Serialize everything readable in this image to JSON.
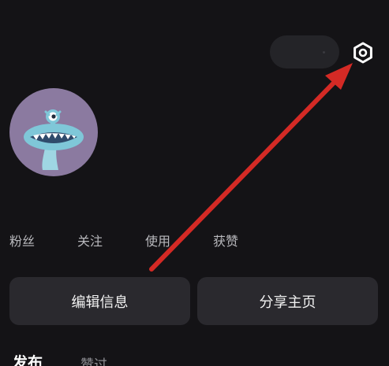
{
  "header": {
    "settings_icon": "gear-icon"
  },
  "profile": {
    "avatar_icon": "monster-avatar"
  },
  "stats": {
    "fans_label": "粉丝",
    "following_label": "关注",
    "usage_label": "使用",
    "likes_label": "获赞"
  },
  "actions": {
    "edit_label": "编辑信息",
    "share_label": "分享主页"
  },
  "tabs": {
    "publish_label": "发布",
    "liked_label": "赞过"
  },
  "colors": {
    "background": "#141316",
    "button_bg": "#2a292e",
    "avatar_bg": "#8b7aa0",
    "annotation_arrow": "#d42a25"
  }
}
